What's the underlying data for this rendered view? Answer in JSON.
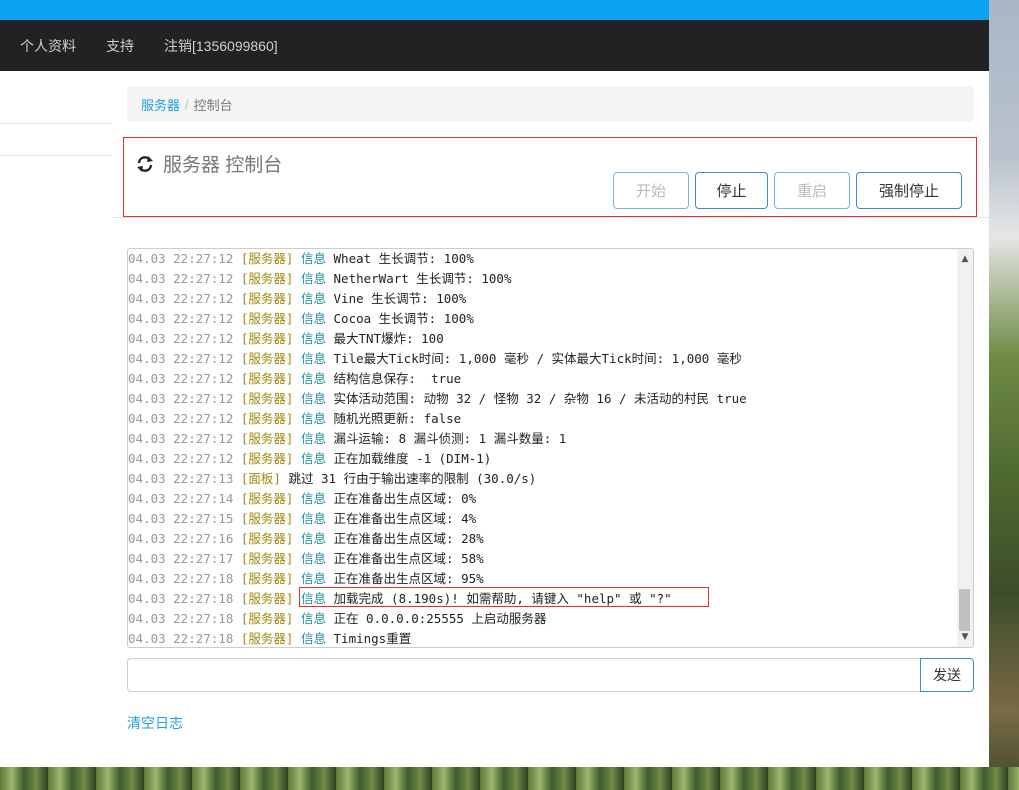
{
  "nav": {
    "items": [
      "个人资料",
      "支持",
      "注销[1356099860]"
    ]
  },
  "breadcrumb": {
    "parent": "服务器",
    "separator": "/",
    "current": "控制台"
  },
  "header": {
    "icon": "refresh-icon",
    "title": "服务器 控制台",
    "buttons": {
      "start": "开始",
      "stop": "停止",
      "restart": "重启",
      "kill": "强制停止"
    }
  },
  "console": {
    "lines": [
      {
        "ts": "04.03 22:27:12",
        "src": "[服务器]",
        "lvl": "信息",
        "msg": "Wheat 生长调节: 100%"
      },
      {
        "ts": "04.03 22:27:12",
        "src": "[服务器]",
        "lvl": "信息",
        "msg": "NetherWart 生长调节: 100%"
      },
      {
        "ts": "04.03 22:27:12",
        "src": "[服务器]",
        "lvl": "信息",
        "msg": "Vine 生长调节: 100%"
      },
      {
        "ts": "04.03 22:27:12",
        "src": "[服务器]",
        "lvl": "信息",
        "msg": "Cocoa 生长调节: 100%"
      },
      {
        "ts": "04.03 22:27:12",
        "src": "[服务器]",
        "lvl": "信息",
        "msg": "最大TNT爆炸: 100"
      },
      {
        "ts": "04.03 22:27:12",
        "src": "[服务器]",
        "lvl": "信息",
        "msg": "Tile最大Tick时间: 1,000 毫秒 / 实体最大Tick时间: 1,000 毫秒"
      },
      {
        "ts": "04.03 22:27:12",
        "src": "[服务器]",
        "lvl": "信息",
        "msg": "结构信息保存:  true"
      },
      {
        "ts": "04.03 22:27:12",
        "src": "[服务器]",
        "lvl": "信息",
        "msg": "实体活动范围: 动物 32 / 怪物 32 / 杂物 16 / 未活动的村民 true"
      },
      {
        "ts": "04.03 22:27:12",
        "src": "[服务器]",
        "lvl": "信息",
        "msg": "随机光照更新: false"
      },
      {
        "ts": "04.03 22:27:12",
        "src": "[服务器]",
        "lvl": "信息",
        "msg": "漏斗运输: 8 漏斗侦测: 1 漏斗数量: 1"
      },
      {
        "ts": "04.03 22:27:12",
        "src": "[服务器]",
        "lvl": "信息",
        "msg": "正在加载维度 -1 (DIM-1)"
      },
      {
        "ts": "04.03 22:27:13",
        "src": "[面板]",
        "lvl": "",
        "msg": "跳过 31 行由于输出速率的限制 (30.0/s)"
      },
      {
        "ts": "04.03 22:27:14",
        "src": "[服务器]",
        "lvl": "信息",
        "msg": "正在准备出生点区域: 0%"
      },
      {
        "ts": "04.03 22:27:15",
        "src": "[服务器]",
        "lvl": "信息",
        "msg": "正在准备出生点区域: 4%"
      },
      {
        "ts": "04.03 22:27:16",
        "src": "[服务器]",
        "lvl": "信息",
        "msg": "正在准备出生点区域: 28%"
      },
      {
        "ts": "04.03 22:27:17",
        "src": "[服务器]",
        "lvl": "信息",
        "msg": "正在准备出生点区域: 58%"
      },
      {
        "ts": "04.03 22:27:18",
        "src": "[服务器]",
        "lvl": "信息",
        "msg": "正在准备出生点区域: 95%"
      },
      {
        "ts": "04.03 22:27:18",
        "src": "[服务器]",
        "lvl": "信息",
        "msg": "加载完成 (8.190s)! 如需帮助, 请键入 \"help\" 或 \"?\""
      },
      {
        "ts": "04.03 22:27:18",
        "src": "[服务器]",
        "lvl": "信息",
        "msg": "正在 0.0.0.0:25555 上启动服务器"
      },
      {
        "ts": "04.03 22:27:18",
        "src": "[服务器]",
        "lvl": "信息",
        "msg": "Timings重置"
      }
    ]
  },
  "command": {
    "value": "",
    "send_label": "发送"
  },
  "clear_log_label": "清空日志",
  "colors": {
    "accent": "#0aa1f1",
    "navbar": "#222222",
    "link": "#20a0e0",
    "highlight_border": "#e0302f"
  }
}
